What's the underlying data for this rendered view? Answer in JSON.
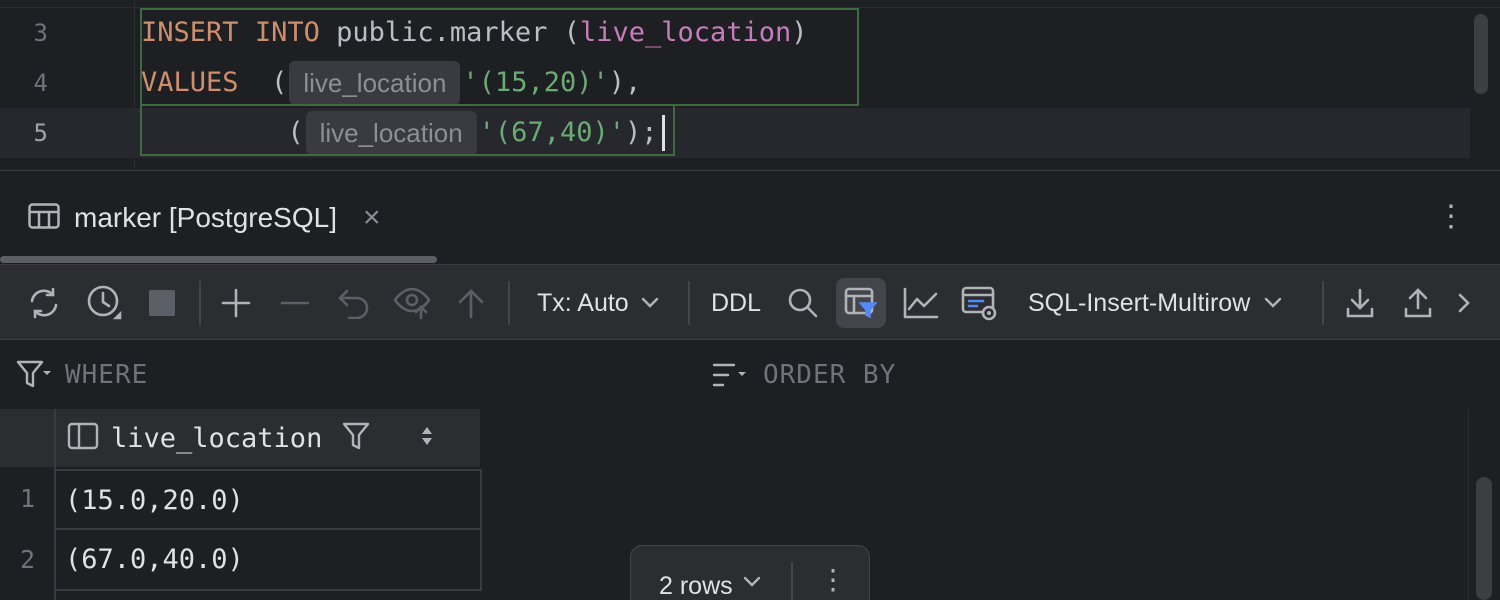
{
  "editor": {
    "lines": [
      {
        "no": "3",
        "kw1": "INSERT",
        "kw2": "INTO",
        "plain": " public.marker (",
        "col": "live_location",
        "close": ")"
      },
      {
        "no": "4",
        "kw": "VALUES",
        "open": "(",
        "hint": "live_location",
        "str": "'(15,20)'",
        "tail": "),"
      },
      {
        "no": "5",
        "open": "(",
        "hint": "live_location",
        "str": "'(67,40)'",
        "tail": ")",
        "semi": ";"
      }
    ]
  },
  "tab": {
    "title": "marker [PostgreSQL]",
    "close": "×",
    "menu": "⋮"
  },
  "toolbar": {
    "tx_label": "Tx: Auto",
    "ddl_label": "DDL",
    "format_label": "SQL-Insert-Multirow"
  },
  "filters": {
    "where_label": "WHERE",
    "orderby_label": "ORDER BY"
  },
  "grid": {
    "column": "live_location",
    "rows": [
      {
        "no": "1",
        "value": "(15.0,20.0)"
      },
      {
        "no": "2",
        "value": "(67.0,40.0)"
      }
    ]
  },
  "rowcount": {
    "label": "2 rows",
    "menu": "⋮"
  },
  "colors": {
    "keyword": "#cf8e6d",
    "column": "#c77dbb",
    "string": "#6aab73",
    "accent": "#548af7"
  }
}
